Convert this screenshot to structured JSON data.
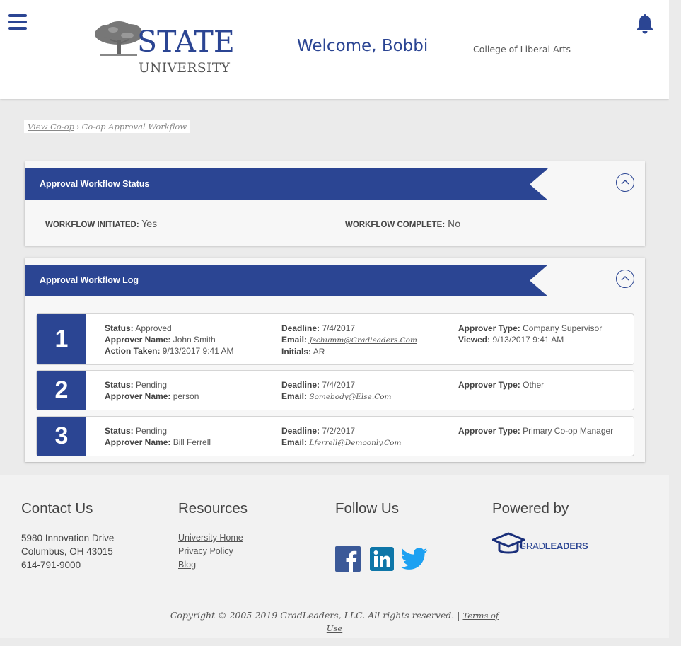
{
  "header": {
    "logo_state": "STATE",
    "logo_university": "UNIVERSITY",
    "welcome": "Welcome, Bobbi",
    "college": "College of Liberal Arts"
  },
  "breadcrumb": {
    "link": "View Co-op",
    "separator": "›",
    "current": "Co-op Approval Workflow"
  },
  "status_panel": {
    "title": "Approval Workflow Status",
    "initiated_label": "WORKFLOW INITIATED:",
    "initiated_value": "Yes",
    "complete_label": "WORKFLOW COMPLETE:",
    "complete_value": "No"
  },
  "log_panel": {
    "title": "Approval Workflow Log",
    "rows": [
      {
        "num": "1",
        "col1": [
          [
            "Status:",
            "Approved"
          ],
          [
            "Approver Name:",
            "John Smith"
          ],
          [
            "Action Taken:",
            "9/13/2017 9:41 AM"
          ]
        ],
        "deadline": "7/4/2017",
        "email": "Jschumm@Gradleaders.Com",
        "initials": "AR",
        "col3": [
          [
            "Approver Type:",
            "Company Supervisor"
          ],
          [
            "Viewed:",
            "9/13/2017 9:41 AM"
          ]
        ]
      },
      {
        "num": "2",
        "col1": [
          [
            "Status:",
            "Pending"
          ],
          [
            "Approver Name:",
            "person"
          ]
        ],
        "deadline": "7/4/2017",
        "email": "Somebody@Else.Com",
        "col3": [
          [
            "Approver Type:",
            "Other"
          ]
        ]
      },
      {
        "num": "3",
        "col1": [
          [
            "Status:",
            "Pending"
          ],
          [
            "Approver Name:",
            "Bill Ferrell"
          ]
        ],
        "deadline": "7/2/2017",
        "email": "Lferrell@Demoonly.Com",
        "col3": [
          [
            "Approver Type:",
            "Primary Co-op Manager"
          ]
        ]
      }
    ],
    "labels": {
      "deadline": "Deadline:",
      "email": "Email:",
      "initials": "Initials:"
    }
  },
  "footer": {
    "contact_title": "Contact Us",
    "contact_lines": [
      "5980 Innovation Drive",
      "Columbus, OH 43015",
      "614-791-9000"
    ],
    "resources_title": "Resources",
    "resources_links": [
      "University Home",
      "Privacy Policy",
      "Blog"
    ],
    "follow_title": "Follow Us",
    "powered_title": "Powered by",
    "gl_grad": "GRAD",
    "gl_leaders": "LEADERS",
    "copyright": "Copyright © 2005-2019 GradLeaders, LLC. All rights reserved. |",
    "terms_part1": "Terms of",
    "terms_part2": "Use"
  },
  "colors": {
    "brand": "#2b4593",
    "facebook": "#3b5998",
    "linkedin": "#0e76a8",
    "twitter": "#1da1f2"
  },
  "icons": [
    "menu-icon",
    "bell-icon",
    "chevron-up-icon",
    "facebook-icon",
    "linkedin-icon",
    "twitter-icon",
    "graduation-cap-icon",
    "oak-tree-icon"
  ]
}
